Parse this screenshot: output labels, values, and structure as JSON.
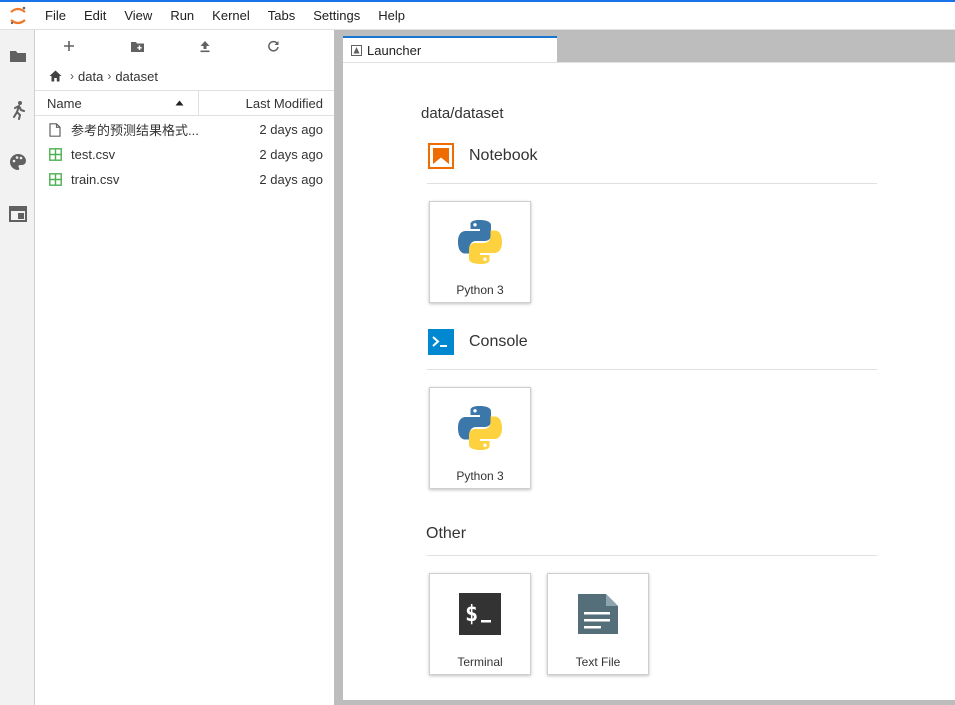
{
  "menu": [
    "File",
    "Edit",
    "View",
    "Run",
    "Kernel",
    "Tabs",
    "Settings",
    "Help"
  ],
  "sidebar": {
    "icons": [
      "folder-icon",
      "running-icon",
      "palette-icon",
      "tabs-icon"
    ]
  },
  "filebrowser": {
    "toolbar": [
      "new-launcher-icon",
      "new-folder-icon",
      "upload-icon",
      "refresh-icon"
    ],
    "breadcrumb": [
      "data",
      "dataset"
    ],
    "columns": {
      "name": "Name",
      "modified": "Last Modified"
    },
    "files": [
      {
        "name": "参考的预测结果格式...",
        "modified": "2 days ago",
        "icon": "file-icon"
      },
      {
        "name": "test.csv",
        "modified": "2 days ago",
        "icon": "spreadsheet-icon"
      },
      {
        "name": "train.csv",
        "modified": "2 days ago",
        "icon": "spreadsheet-icon"
      }
    ]
  },
  "tab": {
    "label": "Launcher"
  },
  "launcher": {
    "cwd": "data/dataset",
    "sections": {
      "notebook": {
        "title": "Notebook",
        "cards": [
          "Python 3"
        ]
      },
      "console": {
        "title": "Console",
        "cards": [
          "Python 3"
        ]
      },
      "other": {
        "title": "Other",
        "cards": [
          "Terminal",
          "Text File"
        ]
      }
    }
  },
  "colors": {
    "accent": "#1976d2",
    "notebook": "#ef6c00",
    "console": "#0288d1",
    "csv": "#4caf50"
  }
}
